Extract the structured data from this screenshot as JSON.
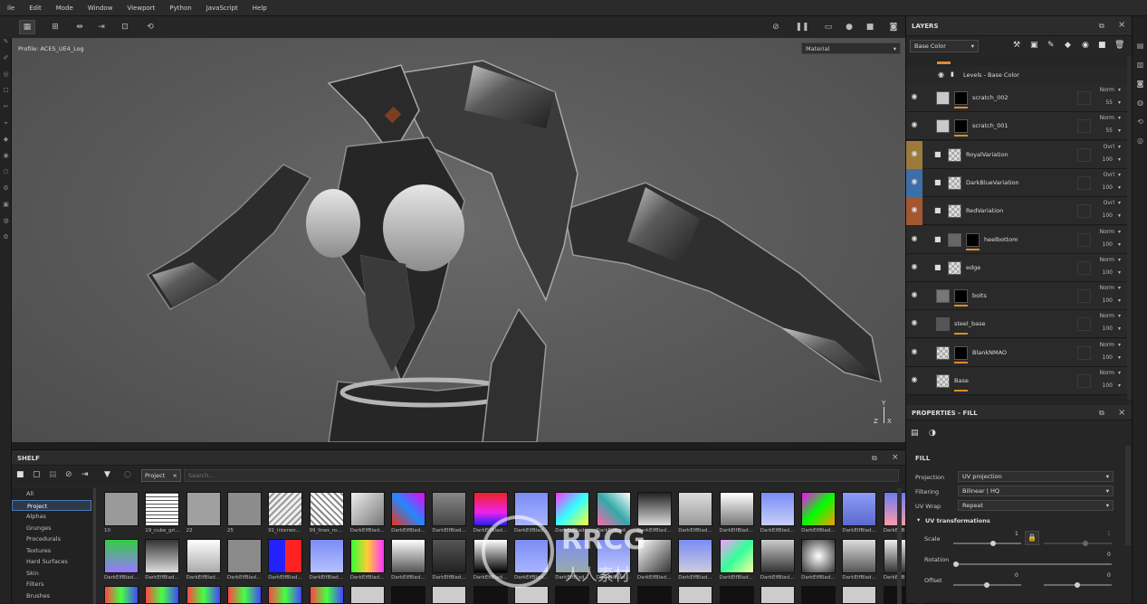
{
  "menubar": {
    "items": [
      "ile",
      "Edit",
      "Mode",
      "Window",
      "Viewport",
      "Python",
      "JavaScript",
      "Help"
    ]
  },
  "viewport": {
    "profile": "Profile: ACES_UE4_Log",
    "material_select": "Material",
    "axes": {
      "y": "Y",
      "z": "Z",
      "x": "X"
    }
  },
  "shelf": {
    "title": "SHELF",
    "filter_tag": "Project",
    "search_placeholder": "Search...",
    "categories": [
      "All",
      "Project",
      "Alphas",
      "Grunges",
      "Procedurals",
      "Textures",
      "Hard Surfaces",
      "Skin",
      "Filters",
      "Brushes"
    ],
    "selected_category": "Project",
    "row1_labels": [
      "10",
      "19_cube_gri...",
      "22",
      "25",
      "91_interwo...",
      "99_lines_ro...",
      "DarkElfBlad...",
      "DarkElfBlad...",
      "DarkElfBlad...",
      "DarkElfBlad...",
      "DarkElfBlad...",
      "DarkElfBlad...",
      "DarkElfBlad...",
      "DarkElfBlad...",
      "DarkElfBlad...",
      "DarkElfBlad...",
      "DarkElfBlad...",
      "DarkElfBlad...",
      "DarkElfBlad...",
      "DarkElfBlad...",
      "DarkElfBlad..."
    ],
    "row2_labels": [
      "DarkElfBlad...",
      "DarkElfBlad...",
      "DarkElfBlad...",
      "DarkElfBlad...",
      "DarkElfBlad...",
      "DarkElfBlad...",
      "DarkElfBlad...",
      "DarkElfBlad...",
      "DarkElfBlad...",
      "DarkElfBlad...",
      "DarkElfBlad...",
      "DarkElfBlad...",
      "DarkElfBlad...",
      "DarkElfBlad...",
      "DarkElfBlad...",
      "DarkElfBlad...",
      "DarkElfBlad...",
      "DarkElfBlad...",
      "DarkElfBlad...",
      "DarkElfBlad...",
      "DarkElfBlad..."
    ]
  },
  "layers": {
    "title": "LAYERS",
    "channel_select": "Base Color",
    "top_effect": "Levels - Base Color",
    "rows": [
      {
        "name": "scratch_002",
        "blend": "Norm",
        "opacity": "55"
      },
      {
        "name": "scratch_001",
        "blend": "Norm",
        "opacity": "55"
      },
      {
        "name": "RoyalVariation",
        "blend": "Ovrl",
        "opacity": "100"
      },
      {
        "name": "DarkBlueVariation",
        "blend": "Ovrl",
        "opacity": "100"
      },
      {
        "name": "RedVariation",
        "blend": "Ovrl",
        "opacity": "100"
      },
      {
        "name": "heelbottom",
        "blend": "Norm",
        "opacity": "100"
      },
      {
        "name": "edge",
        "blend": "Norm",
        "opacity": "100"
      },
      {
        "name": "bolts",
        "blend": "Norm",
        "opacity": "100"
      },
      {
        "name": "steel_base",
        "blend": "Norm",
        "opacity": "100"
      },
      {
        "name": "BlankNMAO",
        "blend": "Norm",
        "opacity": "100"
      },
      {
        "name": "Base",
        "blend": "Norm",
        "opacity": "100"
      }
    ]
  },
  "properties": {
    "title": "PROPERTIES - FILL",
    "section": "FILL",
    "projection_label": "Projection",
    "projection_value": "UV projection",
    "filtering_label": "Filtering",
    "filtering_value": "Bilinear | HQ",
    "uvwrap_label": "UV Wrap",
    "uvwrap_value": "Repeat",
    "uvtrans_label": "UV transformations",
    "scale_label": "Scale",
    "scale_value": "1",
    "scale_value2": "1",
    "rotation_label": "Rotation",
    "rotation_value": "0",
    "offset_label": "Offset",
    "offset_value": "0",
    "offset_value2": "0"
  },
  "watermark": {
    "brand": "RRCG",
    "sub": "人人素材"
  },
  "colors": {
    "accent_orange": "#e08a2a",
    "royal": "#9c7a3a",
    "darkblue": "#3d6ea8",
    "red": "#a4562e",
    "select_blue": "#4a78b5"
  }
}
